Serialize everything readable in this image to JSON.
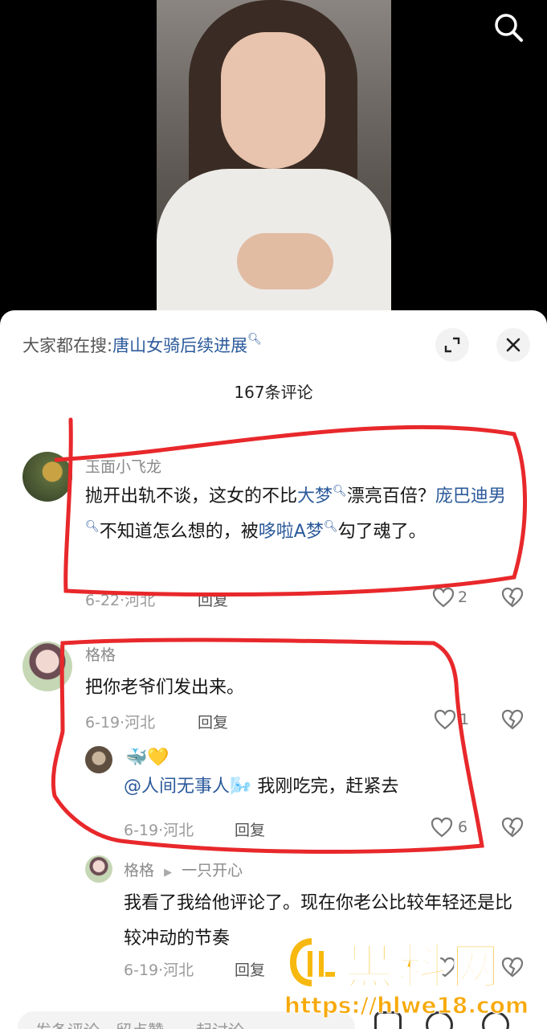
{
  "hot_search": {
    "prefix": "大家都在搜:",
    "term": "唐山女骑后续进展"
  },
  "comment_count": "167条评论",
  "comments": [
    {
      "user": "玉面小飞龙",
      "segments": [
        {
          "text": "抛开出轨不谈，这女的不比",
          "link": false
        },
        {
          "text": "大梦",
          "link": true
        },
        {
          "text": "漂亮百倍？",
          "link": false
        },
        {
          "text": "庞巴迪男",
          "link": true
        },
        {
          "text": "不知道怎么想的，被",
          "link": false
        },
        {
          "text": "哆啦A梦",
          "link": true
        },
        {
          "text": "勾了魂了。",
          "link": false
        }
      ],
      "date": "6-22",
      "location": "河北",
      "reply_label": "回复",
      "likes": "2"
    },
    {
      "user": "格格",
      "text": "把你老爷们发出来。",
      "date": "6-19",
      "location": "河北",
      "reply_label": "回复",
      "likes": "1"
    },
    {
      "user": "🐳💛",
      "mention": "@人间无事人🌬️",
      "text": " 我刚吃完，赶紧去",
      "date": "6-19",
      "location": "河北",
      "reply_label": "回复",
      "likes": "6"
    },
    {
      "user": "格格",
      "reply_to": "一只开心",
      "text": "我看了我给他评论了。现在你老公比较年轻还是比较冲动的节奏",
      "date": "6-19",
      "location": "河北",
      "reply_label": "回复"
    }
  ],
  "input_placeholder": "发条评论，留点赞，一起讨论",
  "watermark": {
    "title": "黑料网",
    "url": "https://hlwe18.com"
  },
  "colors": {
    "link": "#2b5a9b",
    "annotation": "#e8282b",
    "watermark": "#f7b80f"
  }
}
